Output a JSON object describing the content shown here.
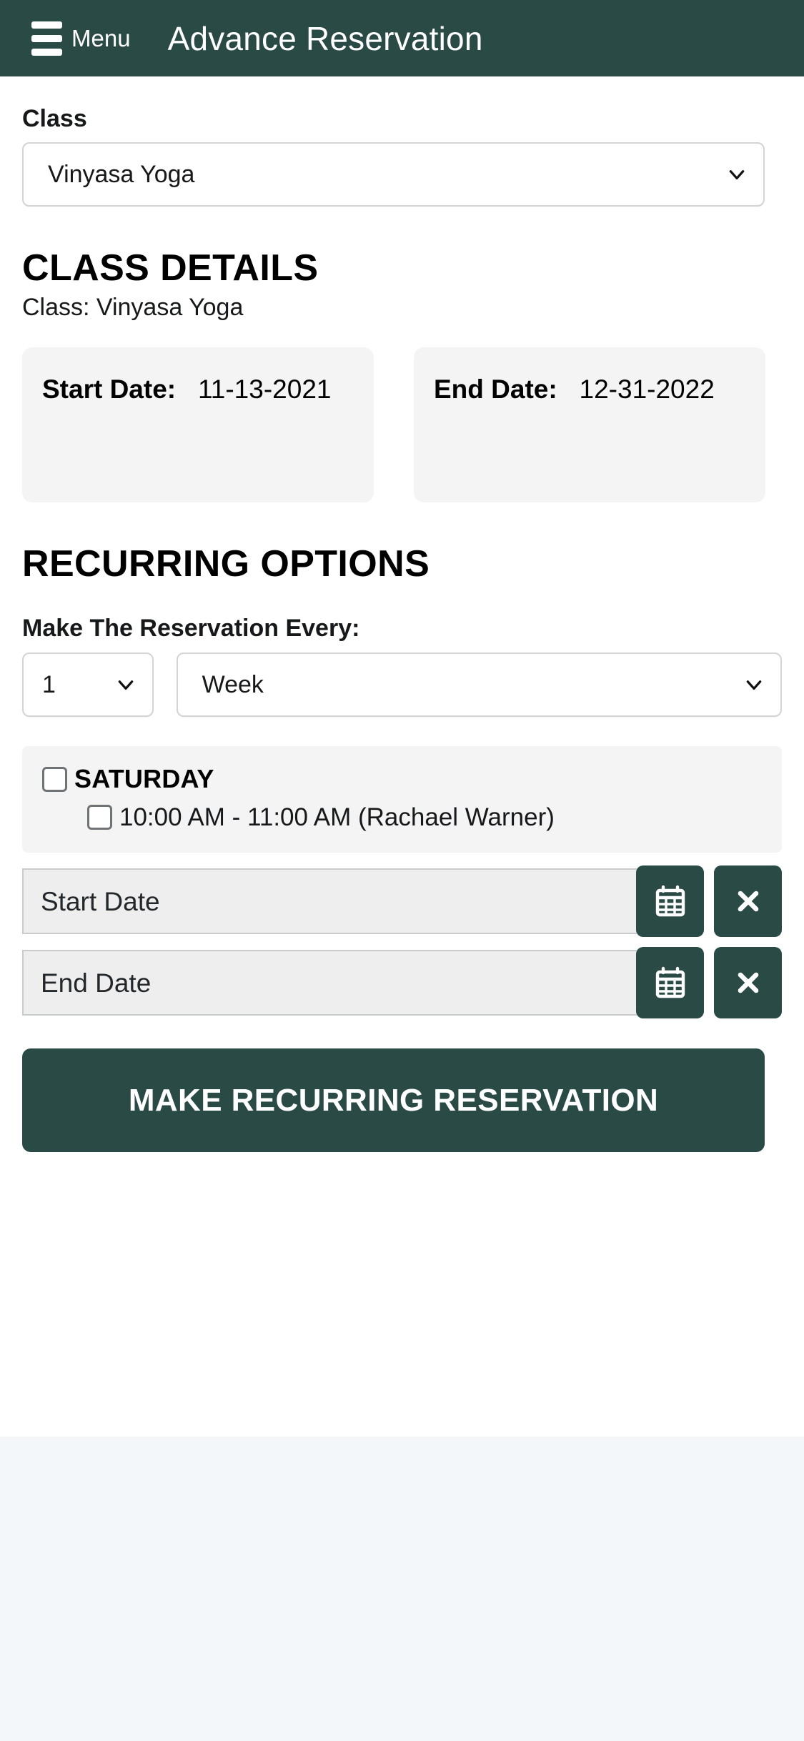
{
  "header": {
    "menu_label": "Menu",
    "title": "Advance Reservation",
    "hamburger_icon": "hamburger-menu-icon",
    "bg_color": "#2a4a45"
  },
  "class_field": {
    "label": "Class",
    "selected": "Vinyasa Yoga",
    "caret_icon": "chevron-down-icon"
  },
  "class_details": {
    "heading": "CLASS DETAILS",
    "class_line": "Class: Vinyasa Yoga",
    "cards": [
      {
        "label": "Start Date:",
        "value": "11-13-2021"
      },
      {
        "label": "End Date:",
        "value": "12-31-2022"
      }
    ]
  },
  "recurring": {
    "heading": "RECURRING OPTIONS",
    "every_label": "Make The Reservation Every:",
    "interval": {
      "selected": "1",
      "caret_icon": "chevron-down-icon"
    },
    "unit": {
      "selected": "Week",
      "caret_icon": "chevron-down-icon"
    },
    "days": [
      {
        "name": "SATURDAY",
        "checked": false,
        "slots": [
          {
            "label": "10:00 AM - 11:00 AM (Rachael Warner)",
            "checked": false
          }
        ]
      }
    ],
    "start_date": {
      "placeholder": "Start Date",
      "value": "",
      "calendar_icon": "calendar-icon",
      "clear_icon": "close-x-icon"
    },
    "end_date": {
      "placeholder": "End Date",
      "value": "",
      "calendar_icon": "calendar-icon",
      "clear_icon": "close-x-icon"
    },
    "submit_label": "MAKE RECURRING RESERVATION"
  },
  "theme": {
    "accent": "#2a4a45",
    "card_bg": "#f4f4f5",
    "footer_bg": "#f4f7fa",
    "input_bg": "#eeeeee"
  }
}
